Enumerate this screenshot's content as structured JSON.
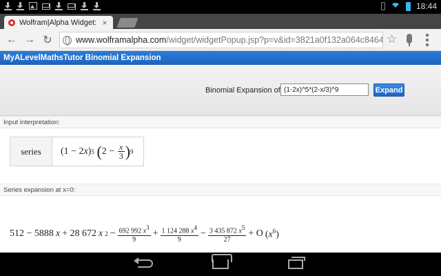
{
  "status_bar": {
    "time": "18:44",
    "notification_icons": [
      "download-icon",
      "download-icon",
      "image-icon",
      "mail-icon",
      "download-icon",
      "mail-icon",
      "download-icon",
      "download-icon"
    ]
  },
  "browser": {
    "tab_title": "Wolfram|Alpha Widget:",
    "tab_close": "×",
    "url_host": "www.wolframalpha.com",
    "url_path": "/widget/widgetPopup.jsp?p=v&id=3821a0f132a064c8464a"
  },
  "page": {
    "banner_title": "MyALevelMathsTutor Binomial Expansion",
    "form_label": "Binomial Expansion of",
    "form_value": "(1-2x)^5*(2-x/3)^9",
    "expand_button": "Expand",
    "input_interpretation_title": "Input interpretation:",
    "interp_left": "series",
    "series_title": "Series expansion at x=0:",
    "series_terms": {
      "t1": "512 − 5888",
      "t2": "+ 28 672",
      "f1_num": "692 992",
      "f1_den": "9",
      "f2_num": "1 124 288",
      "f2_den": "9",
      "f3_num": "3 435 872",
      "f3_den": "27",
      "tail": "+ O"
    }
  },
  "colors": {
    "banner": "#1b64bf",
    "expand_button": "#2f78d4",
    "chrome_tab_bg": "#454545"
  }
}
